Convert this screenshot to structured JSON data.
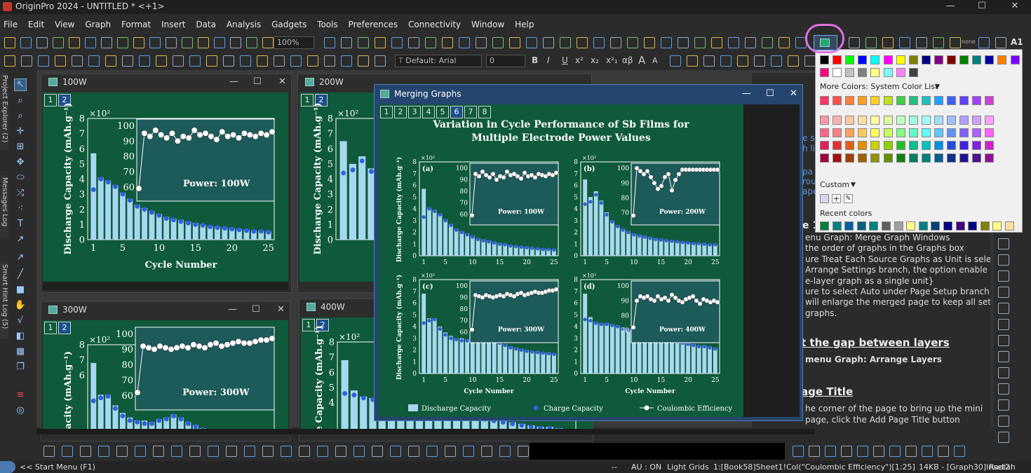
{
  "app": {
    "title": "OriginPro 2024 - UNTITLED * <+1>",
    "close": "✕",
    "restore": "☐",
    "minimize": "—"
  },
  "menu": [
    "File",
    "Edit",
    "View",
    "Graph",
    "Format",
    "Insert",
    "Data",
    "Analysis",
    "Gadgets",
    "Tools",
    "Preferences",
    "Connectivity",
    "Window",
    "Help"
  ],
  "toolbar": {
    "zoom": "100%",
    "font": "Default: Arial",
    "font_size": "0",
    "label_a1": "A1",
    "label_none": "none",
    "bold": "B",
    "italic": "I",
    "underline": "U",
    "sup": "x²",
    "sub": "x₂",
    "supsub": "x²₁",
    "greek": "αβ",
    "size_a": "A",
    "size_a_small": "A"
  },
  "left_tabs": [
    "Project Explorer (2)",
    "Messages Log",
    "Smart Hint Log (5)"
  ],
  "graphs": [
    {
      "title": "100W",
      "tabs": [
        "1",
        "2"
      ],
      "power": "Power: 100W",
      "exp": "×10²",
      "ylabel": "Discharge Capacity (mAh.g⁻¹)",
      "xlabel": "Cycle Number",
      "xticks": [
        "1",
        "5",
        "10",
        "15",
        "20",
        "25"
      ],
      "yticks": [
        "0",
        "1",
        "2",
        "3",
        "4",
        "5",
        "6",
        "7",
        "8"
      ],
      "inset_yticks": [
        "60",
        "70",
        "80",
        "90",
        "100"
      ]
    },
    {
      "title": "200W",
      "tabs": [
        "1",
        "2"
      ],
      "exp": "×10²",
      "ylabel": "Discharge Capacity (mAh.g⁻¹)",
      "yticks": [
        "0",
        "1",
        "2",
        "3",
        "4",
        "5",
        "6",
        "7",
        "8"
      ]
    },
    {
      "title": "300W",
      "tabs": [
        "1",
        "2"
      ],
      "power": "Power: 300W",
      "exp": "×10²",
      "ylabel": "e Capacity (mAh.g⁻¹)",
      "yticks": [
        "6",
        "7",
        "8"
      ],
      "inset_yticks": [
        "60",
        "70",
        "80",
        "90",
        "100"
      ]
    },
    {
      "title": "400W",
      "tabs": [
        "1",
        "2"
      ],
      "exp": "×10²",
      "ylabel": "Discharge Capacity (mAh.g⁻¹)",
      "yticks": [
        "4",
        "5",
        "6",
        "7",
        "8"
      ]
    }
  ],
  "merge": {
    "title": "Merging Graphs",
    "tabs": [
      "1",
      "2",
      "3",
      "4",
      "5",
      "6",
      "7",
      "8"
    ],
    "active_tab": "6",
    "heading_line1": "Variation in Cycle Performance of Sb Films for",
    "heading_line2": "Multiple Electrode Power Values",
    "ylabel": "Discharge Capacity (mAh.g⁻¹)",
    "xlabel": "Cycle Number",
    "exp": "×10²",
    "legend": [
      "Discharge Capacity",
      "Charge Capacity",
      "Coulombic Efficiency"
    ],
    "panels": [
      {
        "label": "(a)",
        "power": "Power: 100W"
      },
      {
        "label": "(b)",
        "power": "Power: 200W"
      },
      {
        "label": "(c)",
        "power": "Power: 300W"
      },
      {
        "label": "(d)",
        "power": "Power: 400W"
      }
    ]
  },
  "chart_data": [
    {
      "type": "bar",
      "title": "(a) Power: 100W",
      "xlabel": "Cycle Number",
      "ylabel": "Discharge Capacity (mAh.g⁻¹)",
      "ylim": [
        0,
        8
      ],
      "x": [
        1,
        2,
        3,
        4,
        5,
        6,
        7,
        8,
        9,
        10,
        11,
        12,
        13,
        14,
        15,
        16,
        17,
        18,
        19,
        20,
        21,
        22,
        23,
        24,
        25
      ],
      "series": [
        {
          "name": "Discharge Capacity",
          "values": [
            5.7,
            4.1,
            3.9,
            3.6,
            3.1,
            2.7,
            2.3,
            2.1,
            1.9,
            1.7,
            1.5,
            1.4,
            1.3,
            1.2,
            1.1,
            1.0,
            0.9,
            0.85,
            0.8,
            0.75,
            0.7,
            0.65,
            0.6,
            0.6,
            0.55
          ]
        },
        {
          "name": "Charge Capacity",
          "values": [
            3.3,
            4.0,
            3.8,
            3.5,
            3.0,
            2.6,
            2.2,
            2.0,
            1.8,
            1.6,
            1.4,
            1.3,
            1.2,
            1.1,
            1.0,
            0.95,
            0.85,
            0.8,
            0.75,
            0.7,
            0.65,
            0.6,
            0.55,
            0.55,
            0.5
          ]
        },
        {
          "name": "Coulombic Efficiency",
          "values": [
            59,
            95,
            93,
            97,
            94,
            92,
            95,
            90,
            93,
            92,
            97,
            94,
            95,
            93,
            91,
            96,
            93,
            94,
            92,
            95,
            94,
            93,
            95,
            94,
            96
          ]
        }
      ]
    },
    {
      "type": "bar",
      "title": "(b) Power: 200W",
      "xlabel": "Cycle Number",
      "ylim": [
        0,
        8
      ],
      "x": [
        1,
        2,
        3,
        4,
        5,
        6,
        7,
        8,
        9,
        10,
        11,
        12,
        13,
        14,
        15,
        16,
        17,
        18,
        19,
        20,
        21,
        22,
        23,
        24,
        25
      ],
      "series": [
        {
          "name": "Discharge Capacity",
          "values": [
            6.5,
            5.0,
            5.5,
            4.7,
            3.7,
            3.0,
            2.6,
            2.3,
            2.1,
            1.9,
            1.8,
            1.7,
            1.6,
            1.5,
            1.4,
            1.35,
            1.3,
            1.25,
            1.2,
            1.15,
            1.1,
            1.1,
            1.05,
            1.0,
            1.0
          ]
        },
        {
          "name": "Charge Capacity",
          "values": [
            4.4,
            4.6,
            5.2,
            4.5,
            3.5,
            2.9,
            2.5,
            2.2,
            2.0,
            1.8,
            1.7,
            1.6,
            1.5,
            1.4,
            1.35,
            1.3,
            1.25,
            1.2,
            1.15,
            1.1,
            1.05,
            1.05,
            1.0,
            0.95,
            0.95
          ]
        },
        {
          "name": "Coulombic Efficiency",
          "values": [
            68,
            100,
            98,
            96,
            98,
            94,
            90,
            86,
            88,
            94,
            96,
            85,
            92,
            96,
            99,
            99,
            99,
            99,
            99,
            99,
            99,
            99,
            99,
            99,
            99
          ]
        }
      ]
    },
    {
      "type": "bar",
      "title": "(c) Power: 300W",
      "xlabel": "Cycle Number",
      "ylim": [
        0,
        8
      ],
      "x": [
        1,
        2,
        3,
        4,
        5,
        6,
        7,
        8,
        9,
        10,
        11,
        12,
        13,
        14,
        15,
        16,
        17,
        18,
        19,
        20,
        21,
        22,
        23,
        24,
        25
      ],
      "series": [
        {
          "name": "Discharge Capacity",
          "values": [
            6.8,
            4.7,
            4.7,
            4.0,
            3.5,
            3.2,
            3.0,
            3.0,
            2.9,
            3.1,
            3.2,
            3.4,
            3.2,
            2.9,
            2.7,
            2.5,
            2.3,
            2.2,
            2.1,
            2.0,
            1.9,
            1.9,
            1.8,
            1.8,
            1.7
          ]
        },
        {
          "name": "Charge Capacity",
          "values": [
            4.3,
            4.5,
            4.6,
            3.8,
            3.3,
            3.0,
            2.9,
            2.8,
            2.8,
            3.0,
            3.1,
            3.3,
            3.1,
            2.8,
            2.6,
            2.4,
            2.2,
            2.1,
            2.0,
            1.9,
            1.85,
            1.8,
            1.75,
            1.7,
            1.65
          ]
        },
        {
          "name": "Coulombic Efficiency",
          "values": [
            62,
            92,
            91,
            90,
            92,
            91,
            90,
            91,
            92,
            91,
            93,
            92,
            91,
            93,
            94,
            92,
            93,
            94,
            95,
            94,
            94,
            95,
            96,
            96,
            97
          ]
        }
      ]
    },
    {
      "type": "bar",
      "title": "(d) Power: 400W",
      "xlabel": "Cycle Number",
      "ylim": [
        0,
        8
      ],
      "x": [
        1,
        2,
        3,
        4,
        5,
        6,
        7,
        8,
        9,
        10,
        11,
        12,
        13,
        14,
        15,
        16,
        17,
        18,
        19,
        20,
        21,
        22,
        23,
        24,
        25
      ],
      "series": [
        {
          "name": "Discharge Capacity",
          "values": [
            6.8,
            4.8,
            4.4,
            4.3,
            4.3,
            4.2,
            4.1,
            3.9,
            3.8,
            3.7,
            3.6,
            3.5,
            3.4,
            3.2,
            3.1,
            3.0,
            2.9,
            2.8,
            2.7,
            2.6,
            2.5,
            2.4,
            2.4,
            2.3,
            2.2
          ]
        },
        {
          "name": "Charge Capacity",
          "values": [
            4.6,
            4.5,
            4.3,
            4.2,
            4.2,
            4.1,
            4.0,
            3.8,
            3.7,
            3.6,
            3.5,
            3.4,
            3.3,
            3.1,
            3.0,
            2.9,
            2.8,
            2.7,
            2.6,
            2.5,
            2.4,
            2.3,
            2.3,
            2.2,
            2.1
          ]
        },
        {
          "name": "Coulombic Efficiency",
          "values": [
            72,
            90,
            93,
            92,
            93,
            91,
            90,
            93,
            91,
            92,
            90,
            94,
            92,
            90,
            89,
            91,
            92,
            93,
            90,
            88,
            91,
            90,
            89,
            90,
            89
          ]
        }
      ]
    }
  ],
  "palette": {
    "more_colors": "More Colors: System Color List",
    "custom": "Custom",
    "recent": "Recent colors",
    "row1": [
      "#000000",
      "#ff0000",
      "#00ff00",
      "#0000ff",
      "#00ffff",
      "#ff00ff",
      "#ffff00",
      "#808000",
      "#000080",
      "#800080",
      "#800000",
      "#008000",
      "#008080",
      "#0000a0",
      "#ff8000",
      "#8000ff"
    ],
    "row2": [
      "#ff0080",
      "#ffffff",
      "#c0c0c0",
      "#808080",
      "#ffff80",
      "#80ffff",
      "#ff80ff",
      "#404040"
    ],
    "sys1": [
      "#ff3366",
      "#ff5050",
      "#ff8040",
      "#ffa020",
      "#ffd020",
      "#c0e020",
      "#40d040",
      "#20c080",
      "#20c0c0",
      "#20a0ff",
      "#4060ff",
      "#6040ff",
      "#a040ff",
      "#d040d0"
    ],
    "grid": [
      [
        "#ff99aa",
        "#ffb0b0",
        "#ffc8a0",
        "#ffe0a0",
        "#ffffa0",
        "#e0ffa0",
        "#c0ffc0",
        "#a0ffe0",
        "#a0ffff",
        "#a0e0ff",
        "#a0c0ff",
        "#b0a0ff",
        "#d0a0ff",
        "#ffa0ff"
      ],
      [
        "#ff6688",
        "#ff8080",
        "#ffa060",
        "#ffc860",
        "#ffff60",
        "#c8ff60",
        "#80ff80",
        "#60ffc8",
        "#60ffff",
        "#60c8ff",
        "#6090ff",
        "#8060ff",
        "#b060ff",
        "#ff60ff"
      ],
      [
        "#e0205a",
        "#e03030",
        "#e06010",
        "#e09000",
        "#d0d000",
        "#90d000",
        "#20c020",
        "#00c090",
        "#00c0c0",
        "#0090e0",
        "#2050e0",
        "#4020e0",
        "#8020e0",
        "#d020d0"
      ],
      [
        "#a00040",
        "#a01010",
        "#a04000",
        "#a06000",
        "#909000",
        "#609000",
        "#108010",
        "#008060",
        "#008080",
        "#006090",
        "#103090",
        "#201090",
        "#501090",
        "#901090"
      ]
    ],
    "recent_colors": [
      "#008040",
      "#008080",
      "#0060a0",
      "#006080",
      "#008080",
      "#606060",
      "#a0a0a0",
      "#ffff80",
      "#008080",
      "#004080",
      "#000080",
      "#400080",
      "#000080",
      "#808000",
      "#ffff80",
      "#ffe0a0"
    ]
  },
  "doc": {
    "lines": [
      {
        "text": "e sl",
        "top": 86
      },
      {
        "text": "h li",
        "top": 101
      },
      {
        "text": "pa",
        "top": 134
      },
      {
        "text": "rou",
        "top": 148
      },
      {
        "text": "ape",
        "top": 162
      },
      {
        "text": "e 1",
        "top": 210,
        "bold": true
      }
    ],
    "body": [
      "enu Graph: Merge Graph Windows",
      "the order of graphs in the Graphs box",
      "ure Treat Each Source Graphs as Unit is selecte",
      "Arrange Settings branch, the option enable to",
      "e-layer graph as a single unit}",
      "ure to select Auto under Page Setup branch, th",
      "will enlarge the merged page to keep all setting",
      "graphs."
    ],
    "h2": "t the gap between layers",
    "h2_body": "menu Graph: Arrange Layers",
    "h3": "age Title",
    "h3_body1": "he corner of the page to bring up the mini",
    "h3_body2": "page, click the Add Page Title button"
  },
  "status": {
    "start": "<< Start Menu (F1)",
    "dash": "--",
    "au": "AU : ON",
    "grid": "Light Grids",
    "col": "1:[Book58]Sheet1!Col(\"Coulombic Efficiency\")[1:25]",
    "size": "14KB - [Graph30]Inset2!",
    "angle": "Radian"
  }
}
